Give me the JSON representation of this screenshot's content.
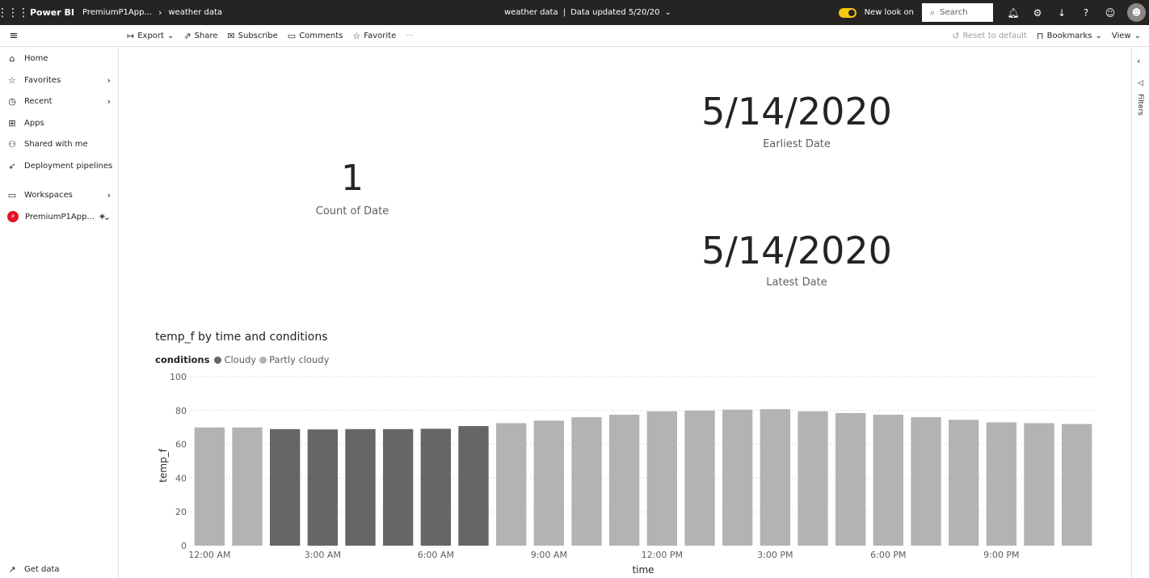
{
  "topbar": {
    "brand": "Power BI",
    "workspace_crumb": "PremiumP1App...",
    "report_crumb": "weather data",
    "report_title": "weather data",
    "data_updated": "Data updated 5/20/20",
    "new_look_label": "New look on",
    "search_placeholder": "Search"
  },
  "actionbar": {
    "export": "Export",
    "share": "Share",
    "subscribe": "Subscribe",
    "comments": "Comments",
    "favorite": "Favorite",
    "more": "···",
    "reset": "Reset to default",
    "bookmarks": "Bookmarks",
    "view": "View"
  },
  "sidebar": {
    "items": [
      {
        "label": "Home",
        "icon": "home-icon"
      },
      {
        "label": "Favorites",
        "icon": "star-icon"
      },
      {
        "label": "Recent",
        "icon": "clock-icon"
      },
      {
        "label": "Apps",
        "icon": "apps-icon"
      },
      {
        "label": "Shared with me",
        "icon": "shared-icon"
      },
      {
        "label": "Deployment pipelines",
        "icon": "rocket-icon"
      },
      {
        "label": "Workspaces",
        "icon": "workspaces-icon"
      },
      {
        "label": "PremiumP1App...",
        "icon": "workspace-avatar"
      }
    ],
    "get_data": "Get data"
  },
  "filters_label": "Filters",
  "cards": {
    "count": {
      "value": "1",
      "label": "Count of Date"
    },
    "earliest": {
      "value": "5/14/2020",
      "label": "Earliest Date"
    },
    "latest": {
      "value": "5/14/2020",
      "label": "Latest Date"
    }
  },
  "colors": {
    "cloudy": "#666666",
    "partly_cloudy": "#b3b3b3",
    "topbar": "#252423",
    "toggle": "#f2c811"
  },
  "chart_data": {
    "type": "bar",
    "title": "temp_f by time and conditions",
    "legend_title": "conditions",
    "legend": [
      "Cloudy",
      "Partly cloudy"
    ],
    "xlabel": "time",
    "ylabel": "temp_f",
    "ylim": [
      0,
      100
    ],
    "yticks": [
      0,
      20,
      40,
      60,
      80,
      100
    ],
    "xtick_labels": [
      "12:00 AM",
      "3:00 AM",
      "6:00 AM",
      "9:00 AM",
      "12:00 PM",
      "3:00 PM",
      "6:00 PM",
      "9:00 PM"
    ],
    "xtick_hours": [
      0,
      3,
      6,
      9,
      12,
      15,
      18,
      21
    ],
    "hours": [
      0,
      1,
      2,
      3,
      4,
      5,
      6,
      7,
      8,
      9,
      10,
      11,
      12,
      13,
      14,
      15,
      16,
      17,
      18,
      19,
      20,
      21,
      22,
      23
    ],
    "values": [
      70,
      70,
      69,
      68.8,
      69,
      69,
      69.2,
      70.8,
      72.5,
      74,
      76,
      77.5,
      79.5,
      80,
      80.5,
      80.8,
      79.5,
      78.5,
      77.5,
      76,
      74.5,
      73,
      72.5,
      72
    ],
    "conditions": [
      "Partly cloudy",
      "Partly cloudy",
      "Cloudy",
      "Cloudy",
      "Cloudy",
      "Cloudy",
      "Cloudy",
      "Cloudy",
      "Partly cloudy",
      "Partly cloudy",
      "Partly cloudy",
      "Partly cloudy",
      "Partly cloudy",
      "Partly cloudy",
      "Partly cloudy",
      "Partly cloudy",
      "Partly cloudy",
      "Partly cloudy",
      "Partly cloudy",
      "Partly cloudy",
      "Partly cloudy",
      "Partly cloudy",
      "Partly cloudy",
      "Partly cloudy"
    ],
    "grid": true
  }
}
